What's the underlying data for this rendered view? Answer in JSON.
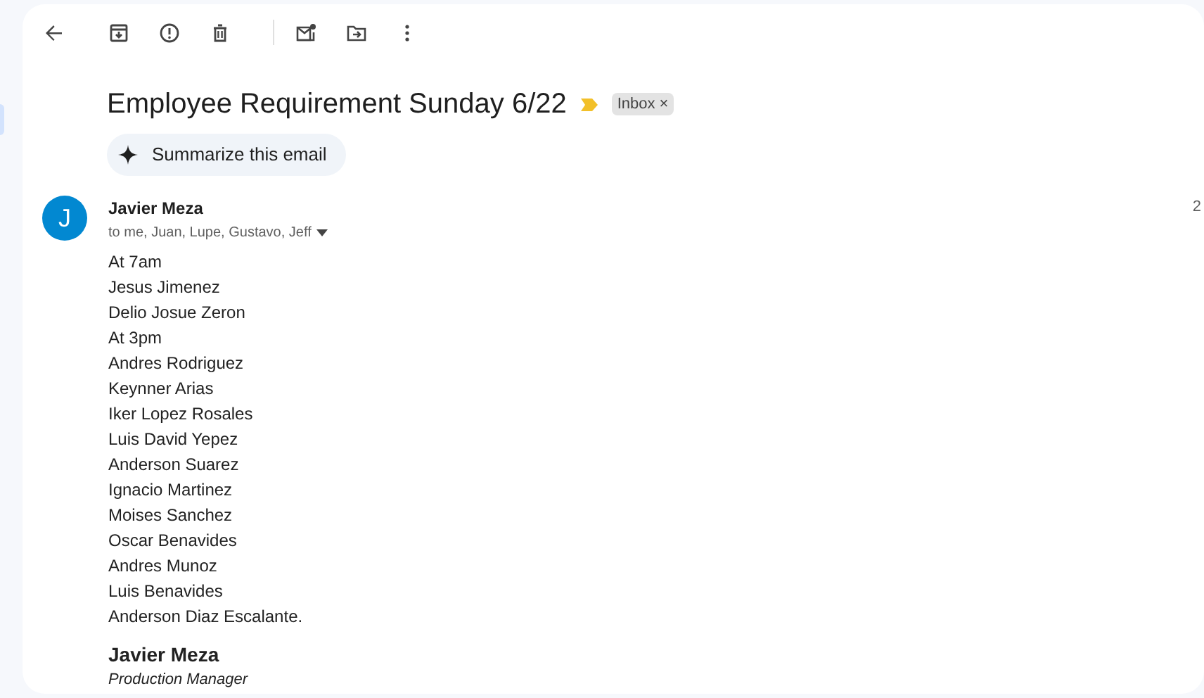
{
  "toolbar": {
    "buttons": [
      {
        "kind": "back"
      },
      {
        "kind": "archive"
      },
      {
        "kind": "report"
      },
      {
        "kind": "delete"
      },
      {
        "kind": "divider"
      },
      {
        "kind": "unread"
      },
      {
        "kind": "move"
      },
      {
        "kind": "more"
      }
    ]
  },
  "subject": "Employee Requirement Sunday 6/22",
  "label": {
    "text": "Inbox",
    "close": "×"
  },
  "summarize": "Summarize this email",
  "message": {
    "avatar": "J",
    "sender": "Javier Meza",
    "recipients": "to me, Juan, Lupe, Gustavo, Jeff",
    "date": "2",
    "body": [
      "At 7am",
      "Jesus Jimenez",
      "Delio Josue Zeron",
      "At 3pm",
      "Andres Rodriguez",
      "Keynner Arias",
      "Iker Lopez Rosales",
      "Luis David Yepez",
      "Anderson Suarez",
      "Ignacio Martinez",
      "Moises Sanchez",
      "Oscar Benavides",
      "Andres Munoz",
      "Luis Benavides",
      "Anderson Diaz Escalante."
    ],
    "signature": {
      "name": "Javier Meza",
      "title": "Production Manager"
    }
  }
}
